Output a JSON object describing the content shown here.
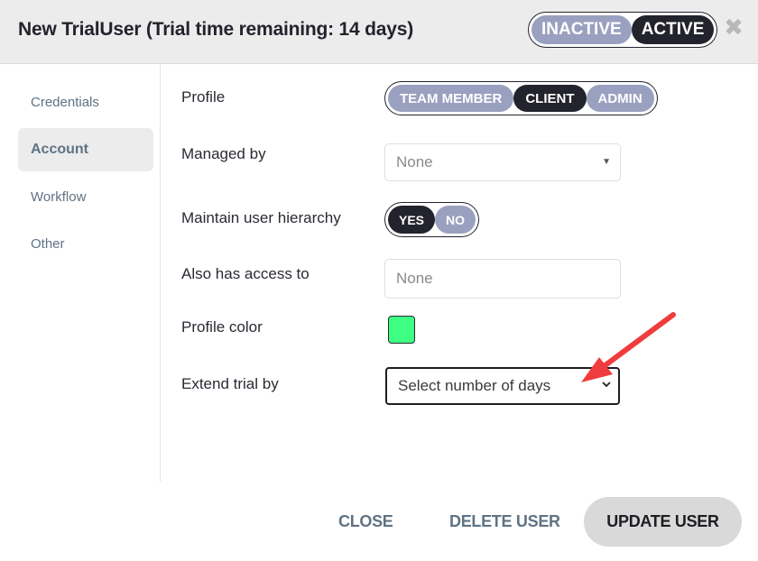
{
  "header": {
    "title": "New TrialUser (Trial time remaining: 14 days)",
    "status_toggle": {
      "options": [
        "INACTIVE",
        "ACTIVE"
      ],
      "selected": "ACTIVE"
    },
    "close_icon": "close-icon"
  },
  "sidebar": {
    "items": [
      {
        "label": "Credentials",
        "active": false
      },
      {
        "label": "Account",
        "active": true
      },
      {
        "label": "Workflow",
        "active": false
      },
      {
        "label": "Other",
        "active": false
      }
    ]
  },
  "form": {
    "profile": {
      "label": "Profile",
      "options": [
        "TEAM MEMBER",
        "CLIENT",
        "ADMIN"
      ],
      "selected": "CLIENT"
    },
    "managed_by": {
      "label": "Managed by",
      "value": "None"
    },
    "hierarchy": {
      "label": "Maintain user hierarchy",
      "options": [
        "YES",
        "NO"
      ],
      "selected": "YES"
    },
    "access": {
      "label": "Also has access to",
      "placeholder": "None"
    },
    "profile_color": {
      "label": "Profile color",
      "color": "#3dff82"
    },
    "extend_trial": {
      "label": "Extend trial by",
      "value": "Select number of days"
    }
  },
  "footer": {
    "close_label": "CLOSE",
    "delete_label": "DELETE USER",
    "update_label": "UPDATE USER"
  },
  "colors": {
    "toggle_on": "#23232d",
    "toggle_off": "#9aa0bf",
    "annotation_arrow": "#f03c3c"
  }
}
